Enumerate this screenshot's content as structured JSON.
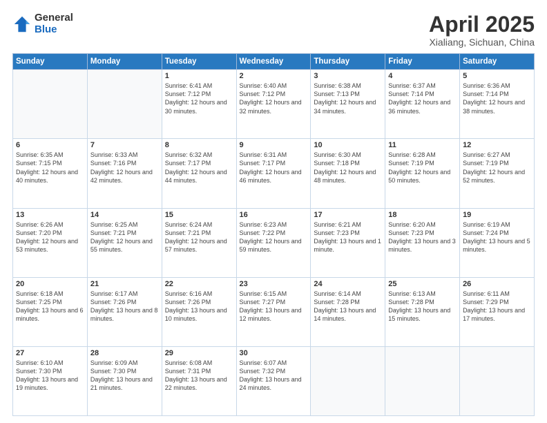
{
  "logo": {
    "general": "General",
    "blue": "Blue"
  },
  "title": "April 2025",
  "subtitle": "Xialiang, Sichuan, China",
  "weekdays": [
    "Sunday",
    "Monday",
    "Tuesday",
    "Wednesday",
    "Thursday",
    "Friday",
    "Saturday"
  ],
  "weeks": [
    [
      {
        "day": "",
        "info": ""
      },
      {
        "day": "",
        "info": ""
      },
      {
        "day": "1",
        "info": "Sunrise: 6:41 AM\nSunset: 7:12 PM\nDaylight: 12 hours and 30 minutes."
      },
      {
        "day": "2",
        "info": "Sunrise: 6:40 AM\nSunset: 7:12 PM\nDaylight: 12 hours and 32 minutes."
      },
      {
        "day": "3",
        "info": "Sunrise: 6:38 AM\nSunset: 7:13 PM\nDaylight: 12 hours and 34 minutes."
      },
      {
        "day": "4",
        "info": "Sunrise: 6:37 AM\nSunset: 7:14 PM\nDaylight: 12 hours and 36 minutes."
      },
      {
        "day": "5",
        "info": "Sunrise: 6:36 AM\nSunset: 7:14 PM\nDaylight: 12 hours and 38 minutes."
      }
    ],
    [
      {
        "day": "6",
        "info": "Sunrise: 6:35 AM\nSunset: 7:15 PM\nDaylight: 12 hours and 40 minutes."
      },
      {
        "day": "7",
        "info": "Sunrise: 6:33 AM\nSunset: 7:16 PM\nDaylight: 12 hours and 42 minutes."
      },
      {
        "day": "8",
        "info": "Sunrise: 6:32 AM\nSunset: 7:17 PM\nDaylight: 12 hours and 44 minutes."
      },
      {
        "day": "9",
        "info": "Sunrise: 6:31 AM\nSunset: 7:17 PM\nDaylight: 12 hours and 46 minutes."
      },
      {
        "day": "10",
        "info": "Sunrise: 6:30 AM\nSunset: 7:18 PM\nDaylight: 12 hours and 48 minutes."
      },
      {
        "day": "11",
        "info": "Sunrise: 6:28 AM\nSunset: 7:19 PM\nDaylight: 12 hours and 50 minutes."
      },
      {
        "day": "12",
        "info": "Sunrise: 6:27 AM\nSunset: 7:19 PM\nDaylight: 12 hours and 52 minutes."
      }
    ],
    [
      {
        "day": "13",
        "info": "Sunrise: 6:26 AM\nSunset: 7:20 PM\nDaylight: 12 hours and 53 minutes."
      },
      {
        "day": "14",
        "info": "Sunrise: 6:25 AM\nSunset: 7:21 PM\nDaylight: 12 hours and 55 minutes."
      },
      {
        "day": "15",
        "info": "Sunrise: 6:24 AM\nSunset: 7:21 PM\nDaylight: 12 hours and 57 minutes."
      },
      {
        "day": "16",
        "info": "Sunrise: 6:23 AM\nSunset: 7:22 PM\nDaylight: 12 hours and 59 minutes."
      },
      {
        "day": "17",
        "info": "Sunrise: 6:21 AM\nSunset: 7:23 PM\nDaylight: 13 hours and 1 minute."
      },
      {
        "day": "18",
        "info": "Sunrise: 6:20 AM\nSunset: 7:23 PM\nDaylight: 13 hours and 3 minutes."
      },
      {
        "day": "19",
        "info": "Sunrise: 6:19 AM\nSunset: 7:24 PM\nDaylight: 13 hours and 5 minutes."
      }
    ],
    [
      {
        "day": "20",
        "info": "Sunrise: 6:18 AM\nSunset: 7:25 PM\nDaylight: 13 hours and 6 minutes."
      },
      {
        "day": "21",
        "info": "Sunrise: 6:17 AM\nSunset: 7:26 PM\nDaylight: 13 hours and 8 minutes."
      },
      {
        "day": "22",
        "info": "Sunrise: 6:16 AM\nSunset: 7:26 PM\nDaylight: 13 hours and 10 minutes."
      },
      {
        "day": "23",
        "info": "Sunrise: 6:15 AM\nSunset: 7:27 PM\nDaylight: 13 hours and 12 minutes."
      },
      {
        "day": "24",
        "info": "Sunrise: 6:14 AM\nSunset: 7:28 PM\nDaylight: 13 hours and 14 minutes."
      },
      {
        "day": "25",
        "info": "Sunrise: 6:13 AM\nSunset: 7:28 PM\nDaylight: 13 hours and 15 minutes."
      },
      {
        "day": "26",
        "info": "Sunrise: 6:11 AM\nSunset: 7:29 PM\nDaylight: 13 hours and 17 minutes."
      }
    ],
    [
      {
        "day": "27",
        "info": "Sunrise: 6:10 AM\nSunset: 7:30 PM\nDaylight: 13 hours and 19 minutes."
      },
      {
        "day": "28",
        "info": "Sunrise: 6:09 AM\nSunset: 7:30 PM\nDaylight: 13 hours and 21 minutes."
      },
      {
        "day": "29",
        "info": "Sunrise: 6:08 AM\nSunset: 7:31 PM\nDaylight: 13 hours and 22 minutes."
      },
      {
        "day": "30",
        "info": "Sunrise: 6:07 AM\nSunset: 7:32 PM\nDaylight: 13 hours and 24 minutes."
      },
      {
        "day": "",
        "info": ""
      },
      {
        "day": "",
        "info": ""
      },
      {
        "day": "",
        "info": ""
      }
    ]
  ]
}
